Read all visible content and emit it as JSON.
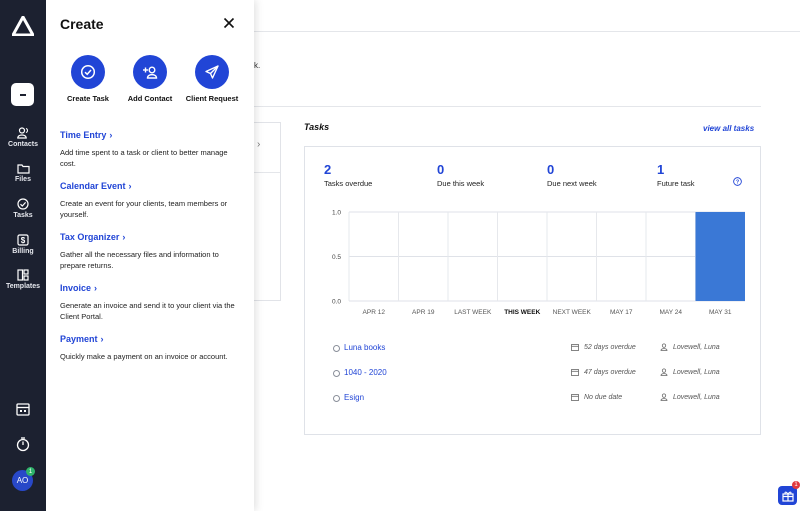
{
  "sidebar": {
    "nav": [
      {
        "label": "Contacts",
        "icon": "contacts-icon"
      },
      {
        "label": "Files",
        "icon": "files-icon"
      },
      {
        "label": "Tasks",
        "icon": "tasks-icon"
      },
      {
        "label": "Billing",
        "icon": "billing-icon"
      },
      {
        "label": "Templates",
        "icon": "templates-icon"
      }
    ],
    "avatar_initials": "AO",
    "avatar_badge": "1"
  },
  "create_panel": {
    "title": "Create",
    "quick_actions": [
      {
        "label": "Create Task",
        "icon": "check-circle-icon"
      },
      {
        "label": "Add Contact",
        "icon": "add-contact-icon"
      },
      {
        "label": "Client Request",
        "icon": "paper-plane-icon"
      }
    ],
    "options": [
      {
        "title": "Time Entry",
        "description": "Add time spent to a task or client to better manage cost."
      },
      {
        "title": "Calendar Event",
        "description": "Create an event for your clients, team members or yourself."
      },
      {
        "title": "Tax Organizer",
        "description": "Gather all the necessary files and information to prepare returns."
      },
      {
        "title": "Invoice",
        "description": "Generate an invoice and send it to your client via the Client Portal."
      },
      {
        "title": "Payment",
        "description": "Quickly make a payment on an invoice or account."
      }
    ]
  },
  "background": {
    "partial_text": "k."
  },
  "tasks": {
    "heading": "Tasks",
    "view_all": "view all tasks",
    "stats": [
      {
        "number": "2",
        "label": "Tasks overdue"
      },
      {
        "number": "0",
        "label": "Due this week"
      },
      {
        "number": "0",
        "label": "Due next week"
      },
      {
        "number": "1",
        "label": "Future task"
      }
    ],
    "list": [
      {
        "name": "Luna books",
        "due": "52 days overdue",
        "owner": "Lovewell, Luna"
      },
      {
        "name": "1040 - 2020",
        "due": "47 days overdue",
        "owner": "Lovewell, Luna"
      },
      {
        "name": "Esign",
        "due": "No due date",
        "owner": "Lovewell, Luna"
      }
    ]
  },
  "chart_data": {
    "type": "bar",
    "categories": [
      "APR 12",
      "APR 19",
      "LAST WEEK",
      "THIS WEEK",
      "NEXT WEEK",
      "MAY 17",
      "MAY 24",
      "MAY 31"
    ],
    "values": [
      0,
      0,
      0,
      0,
      0,
      0,
      0,
      1
    ],
    "ylim": [
      0,
      1
    ],
    "yticks": [
      "0.0",
      "0.5",
      "1.0"
    ],
    "highlight_category": "THIS WEEK",
    "bar_color": "#3a78d6",
    "grid": true
  },
  "gift_badge": "1",
  "colors": {
    "sidebar_bg": "#1c2130",
    "accent": "#2145d6",
    "bar": "#3a78d6"
  }
}
